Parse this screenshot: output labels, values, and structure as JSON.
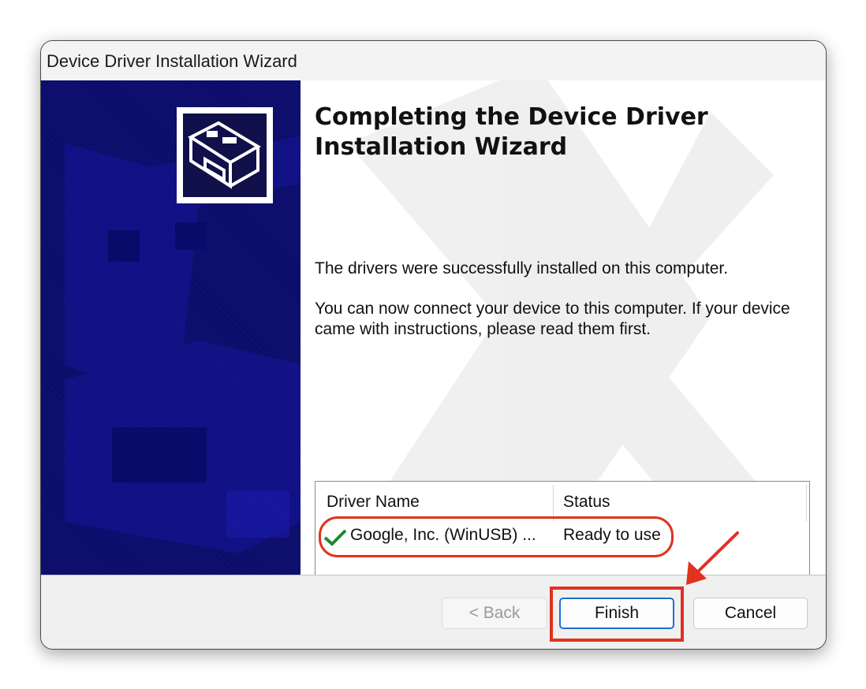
{
  "window": {
    "title": "Device Driver Installation Wizard"
  },
  "content": {
    "heading": "Completing the Device Driver Installation Wizard",
    "paragraph1": "The drivers were successfully installed on this computer.",
    "paragraph2": "You can now connect your device to this computer. If your device came with instructions, please read them first."
  },
  "driver_list": {
    "columns": [
      "Driver Name",
      "Status"
    ],
    "rows": [
      {
        "icon": "checkmark-icon",
        "name": "Google, Inc. (WinUSB) ...",
        "status": "Ready to use"
      }
    ]
  },
  "buttons": {
    "back": "< Back",
    "finish": "Finish",
    "cancel": "Cancel"
  },
  "annotations": {
    "highlight_color": "#e0321e"
  },
  "colors": {
    "sidebar": "#0a0a6a",
    "checkmark": "#1e8a2e",
    "default_button_border": "#1f6fd1"
  }
}
